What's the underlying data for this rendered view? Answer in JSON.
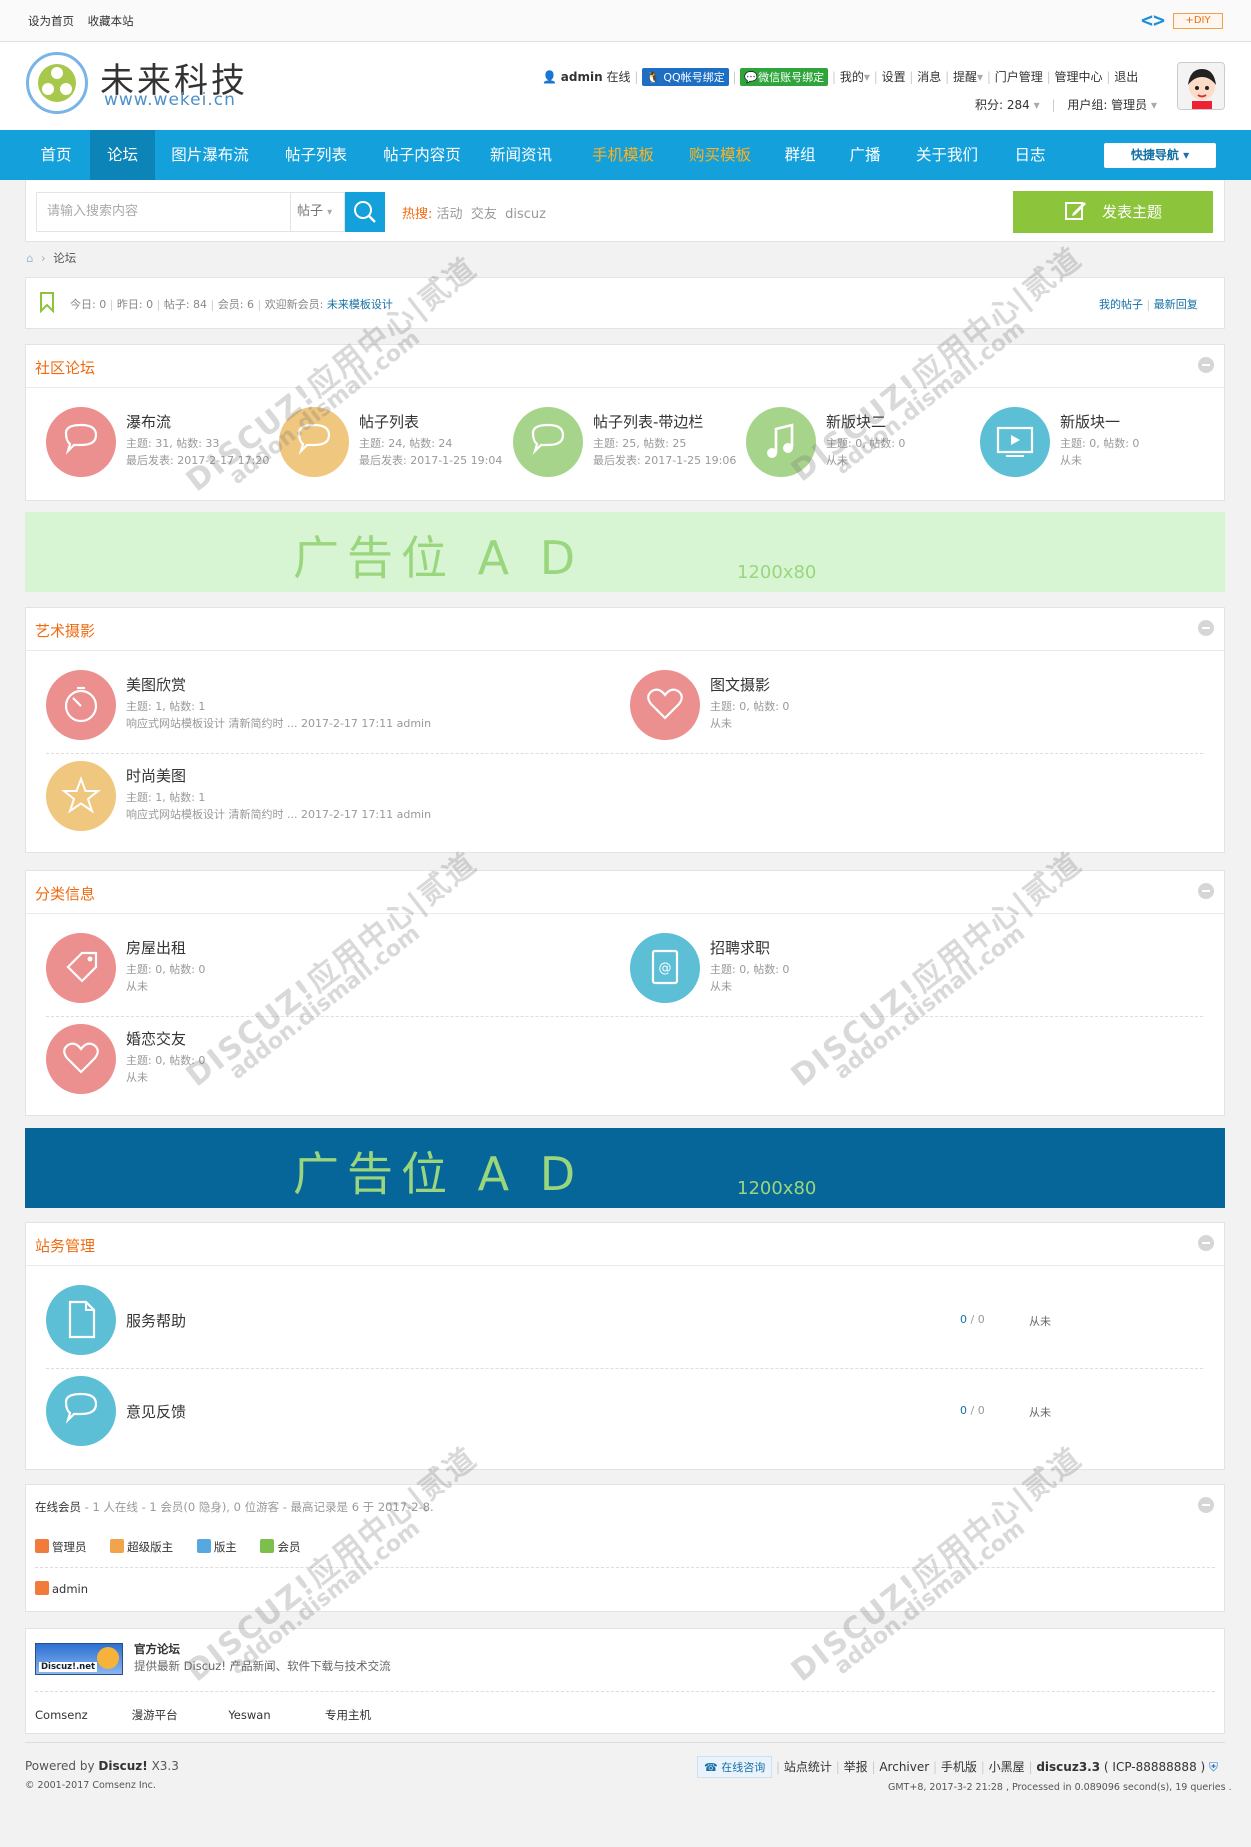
{
  "topbar": {
    "set_home": "设为首页",
    "bookmark": "收藏本站",
    "diy": "DIY"
  },
  "logo": {
    "title": "未来科技",
    "subtitle": "www.wekei.cn"
  },
  "user": {
    "name": "admin",
    "status": "在线",
    "qq_bind": "QQ帐号绑定",
    "wechat_bind": "微信账号绑定",
    "links": [
      "我的",
      "设置",
      "消息",
      "提醒",
      "门户管理",
      "管理中心",
      "退出"
    ],
    "credits": "积分: 284",
    "group": "用户组: 管理员"
  },
  "nav": {
    "items": [
      "首页",
      "论坛",
      "图片瀑布流",
      "帖子列表",
      "帖子内容页",
      "新闻资讯",
      "手机模板",
      "购买模板",
      "群组",
      "广播",
      "关于我们",
      "日志"
    ],
    "quick": "快捷导航"
  },
  "search": {
    "placeholder": "请输入搜索内容",
    "type": "帖子",
    "hot_label": "热搜:",
    "hot": [
      "活动",
      "交友",
      "discuz"
    ],
    "post_button": "发表主题"
  },
  "breadcrumb": {
    "current": "论坛"
  },
  "stats": {
    "today": "今日: 0",
    "yesterday": "昨日: 0",
    "posts": "帖子: 84",
    "members": "会员: 6",
    "welcome": "欢迎新会员:",
    "new_member": "未来模板设计",
    "my_posts": "我的帖子",
    "latest_reply": "最新回复"
  },
  "sections": {
    "community": {
      "title": "社区论坛",
      "forums": [
        {
          "name": "瀑布流",
          "l1": "主题: 31, 帖数: 33",
          "l2": "最后发表: 2017-2-17 17:20",
          "color": "#ec8f8f",
          "icon": "chat-icon"
        },
        {
          "name": "帖子列表",
          "l1": "主题: 24, 帖数: 24",
          "l2": "最后发表: 2017-1-25 19:04",
          "color": "#f0c77f",
          "icon": "chat-icon"
        },
        {
          "name": "帖子列表-带边栏",
          "l1": "主题: 25, 帖数: 25",
          "l2": "最后发表: 2017-1-25 19:06",
          "color": "#a7d48b",
          "icon": "chat-icon"
        },
        {
          "name": "新版块二",
          "l1": "主题: 0, 帖数: 0",
          "l2": "从未",
          "color": "#a7d48b",
          "icon": "music-icon"
        },
        {
          "name": "新版块一",
          "l1": "主题: 0, 帖数: 0",
          "l2": "从未",
          "color": "#5cbfd6",
          "icon": "video-icon"
        }
      ]
    },
    "art": {
      "title": "艺术摄影",
      "forums": [
        {
          "name": "美图欣赏",
          "l1": "主题: 1, 帖数: 1",
          "l2": "响应式网站模板设计 清新简约时 ... 2017-2-17 17:11 admin",
          "color": "#ec8f8f",
          "icon": "timer-icon"
        },
        {
          "name": "图文摄影",
          "l1": "主题: 0, 帖数: 0",
          "l2": "从未",
          "color": "#ec8f8f",
          "icon": "heart-icon"
        },
        {
          "name": "时尚美图",
          "l1": "主题: 1, 帖数: 1",
          "l2": "响应式网站模板设计 清新简约时 ... 2017-2-17 17:11 admin",
          "color": "#f0c77f",
          "icon": "star-icon"
        }
      ]
    },
    "classified": {
      "title": "分类信息",
      "forums": [
        {
          "name": "房屋出租",
          "l1": "主题: 0, 帖数: 0",
          "l2": "从未",
          "color": "#ec8f8f",
          "icon": "tag-icon"
        },
        {
          "name": "招聘求职",
          "l1": "主题: 0, 帖数: 0",
          "l2": "从未",
          "color": "#5cbfd6",
          "icon": "contact-book-icon"
        },
        {
          "name": "婚恋交友",
          "l1": "主题: 0, 帖数: 0",
          "l2": "从未",
          "color": "#ec8f8f",
          "icon": "heart-icon"
        }
      ]
    },
    "admin": {
      "title": "站务管理",
      "forums": [
        {
          "name": "服务帮助",
          "count_a": "0",
          "count_b": "0",
          "last": "从未",
          "color": "#5cbfd6",
          "icon": "document-icon"
        },
        {
          "name": "意见反馈",
          "count_a": "0",
          "count_b": "0",
          "last": "从未",
          "color": "#5cbfd6",
          "icon": "chat-icon"
        }
      ]
    }
  },
  "ads": [
    {
      "text": "广告位 A D",
      "size": "1200x80",
      "bg": "#d8f5d3",
      "fg": "#9ad67d"
    },
    {
      "text": "广告位 A D",
      "size": "1200x80",
      "bg": "#076699",
      "fg": "#9ad67d"
    }
  ],
  "online": {
    "title": "在线会员",
    "summary": "- 1 人在线 - 1 会员(0 隐身), 0 位游客 - 最高记录是 6 于 2017-2-8.",
    "groups": [
      "管理员",
      "超级版主",
      "版主",
      "会员"
    ],
    "users": [
      "admin"
    ]
  },
  "links_box": {
    "name": "官方论坛",
    "desc": "提供最新 Discuz! 产品新闻、软件下载与技术交流",
    "logo_text": "Discuz!.net",
    "links": [
      "Comsenz",
      "漫游平台",
      "Yeswan",
      "专用主机"
    ]
  },
  "footer": {
    "powered": "Powered by",
    "brand": "Discuz!",
    "version": "X3.3",
    "copyright": "© 2001-2017 Comsenz Inc.",
    "consult": "在线咨询",
    "links": [
      "站点统计",
      "举报",
      "Archiver",
      "手机版",
      "小黑屋"
    ],
    "site": "discuz3.3",
    "icp": "( ICP-88888888 )",
    "gmt": "GMT+8, 2017-3-2 21:28 , Processed in 0.089096 second(s), 19 queries ."
  },
  "watermark": {
    "line1": "DISCUZ!应用中心|贰道",
    "line2": "addon.dismall.com"
  }
}
